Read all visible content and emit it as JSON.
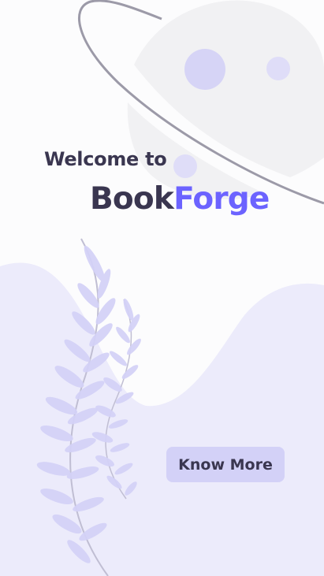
{
  "welcome": {
    "line": "Welcome to",
    "brand_primary": "Book",
    "brand_accent": "Forge"
  },
  "cta": {
    "label": "Know More"
  },
  "colors": {
    "text_dark": "#3A3650",
    "accent": "#6C63FF",
    "button_bg": "#D3D1F7",
    "hill": "#ECEBFB",
    "planet": "#F1F1F3",
    "crater": "#D6D4F6",
    "ring": "#9C9AA8",
    "leaf": "#D4D2F7"
  }
}
